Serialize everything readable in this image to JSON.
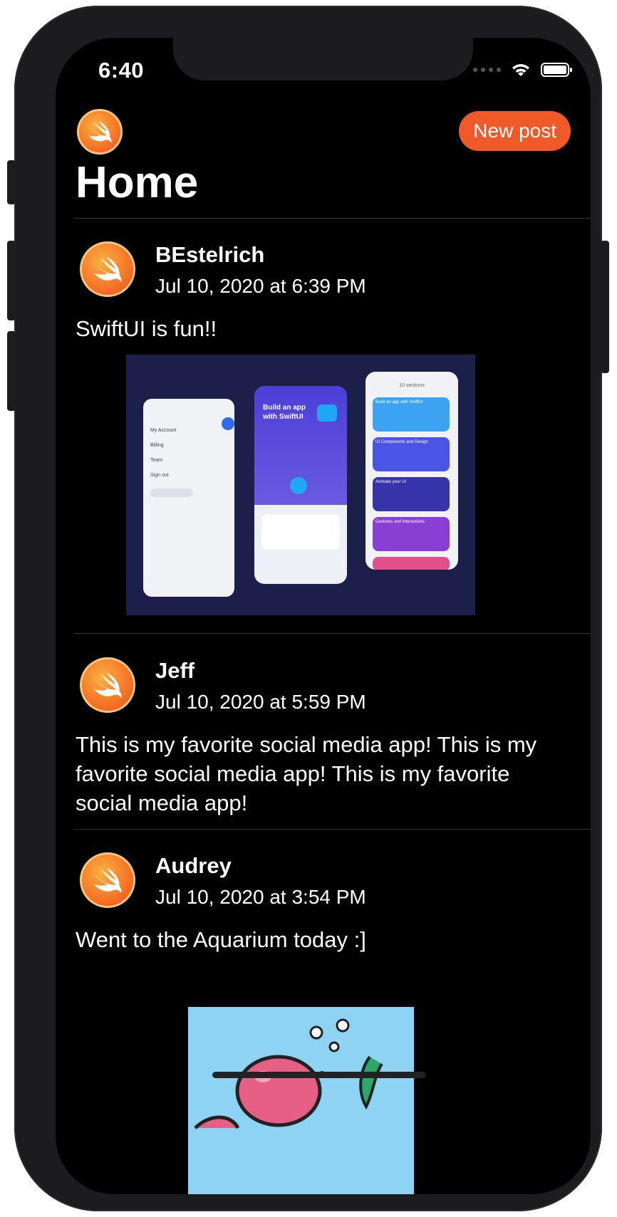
{
  "status": {
    "time": "6:40"
  },
  "nav": {
    "new_post_label": "New post"
  },
  "page": {
    "title": "Home"
  },
  "posts": [
    {
      "user": "BEstelrich",
      "date": "Jul 10, 2020 at 6:39 PM",
      "text": "SwiftUI is fun!!"
    },
    {
      "user": "Jeff",
      "date": "Jul 10, 2020 at 5:59 PM",
      "text": "This is my favorite social media app! This is my favorite social media app! This is my favorite social media app!"
    },
    {
      "user": "Audrey",
      "date": "Jul 10, 2020 at 3:54 PM",
      "text": "Went to the Aquarium today :]"
    }
  ],
  "app_preview": {
    "menu_items": [
      "My Account",
      "Billing",
      "Team",
      "Sign out"
    ],
    "hero_title": "Build an app with SwiftUI",
    "card_title": "10 sections",
    "course_cards": [
      "Build an app with SwiftUI",
      "UI Components and Design",
      "Animate your UI",
      "Gestures and Interactions"
    ],
    "color_accent": "#3d4fe0"
  },
  "colors": {
    "accent": "#f05a28",
    "background": "#000000"
  }
}
